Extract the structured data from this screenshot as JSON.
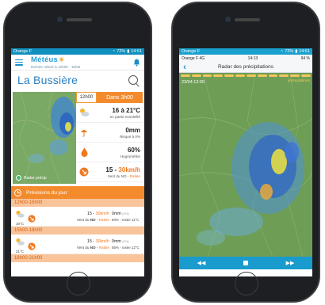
{
  "left": {
    "status": {
      "carrier": "Orange F",
      "battery": "72%",
      "time": "14:51"
    },
    "header": {
      "logo": "Météus",
      "subtitle": "Dernier relevé à 12h00 - 15/05"
    },
    "city": "La Bussière",
    "hour_tabs": {
      "now": "12h00",
      "next": "Dans 3h00"
    },
    "cards": {
      "temp": {
        "value": "16 à 21°C",
        "sub": "en partie ensoleillé"
      },
      "rain": {
        "value": "0mm",
        "sub": "Risque à 0%"
      },
      "humidity": {
        "value": "60%",
        "sub": "Hygrométrie"
      },
      "wind": {
        "value_a": "15 - ",
        "value_b": "30km/h",
        "sub_a": "Vent du NO - ",
        "sub_b": "Rafale"
      }
    },
    "radar_label": "Radar précip",
    "forecast": {
      "title": "Prévisions du jour",
      "slots": [
        {
          "time": "12h00-15h00",
          "temp": "19°C",
          "wind_a": "15 - ",
          "wind_b": "30km/h",
          "dir_a": "Vent du ",
          "dir_b": "NO",
          "dir_c": " - ",
          "dir_d": "Rafale",
          "precip": "0mm",
          "precip_note": "(0%)",
          "hum": "60% - rosée 11°C"
        },
        {
          "time": "15h00-18h00",
          "temp": "21°C",
          "wind_a": "15 - ",
          "wind_b": "30km/h",
          "dir_a": "Vent du ",
          "dir_b": "NO",
          "dir_c": " - ",
          "dir_d": "Rafale",
          "precip": "0mm",
          "precip_note": "(0%)",
          "hum": "55% - rosée 12°C"
        }
      ],
      "next_time": "18h00-21h00"
    },
    "colors": {
      "accent": "#f38b2c",
      "brand": "#2b7fc0"
    }
  },
  "right": {
    "status": {
      "carrier": "Orange F",
      "battery": "72%",
      "time": "14:51"
    },
    "status2": {
      "carrier": "Orange F",
      "network": "4G",
      "time": "14:13",
      "battery": "94 %"
    },
    "title": "Radar des précipitations",
    "timestamp": "23/04 12:00",
    "legend": "précipitations"
  }
}
